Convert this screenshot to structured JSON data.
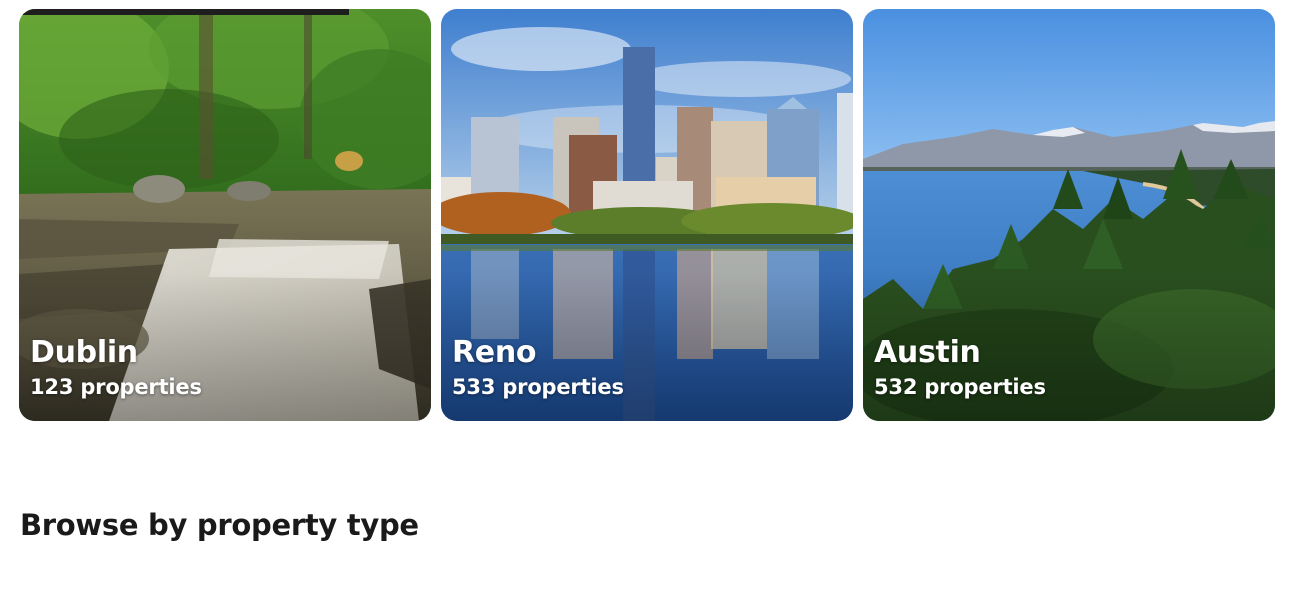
{
  "destinations": [
    {
      "city": "Dublin",
      "count": "123 properties",
      "image": "waterfall-forest-photo"
    },
    {
      "city": "Reno",
      "count": "533 properties",
      "image": "city-skyline-reflection-photo"
    },
    {
      "city": "Austin",
      "count": "532 properties",
      "image": "mountain-lake-pines-photo"
    }
  ],
  "browse_section": {
    "title": "Browse by property type"
  }
}
